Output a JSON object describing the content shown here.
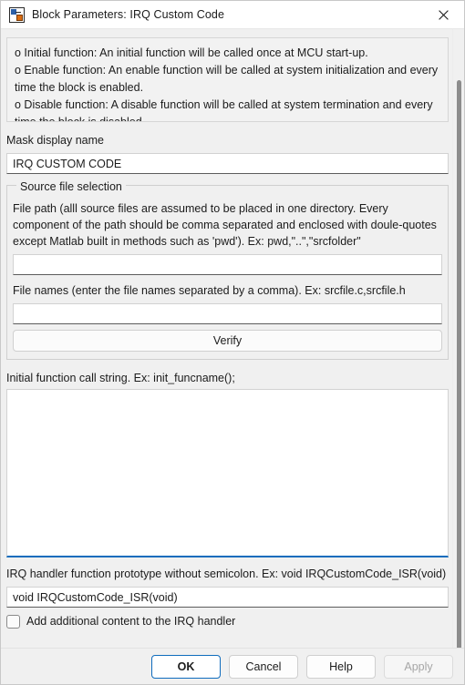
{
  "window": {
    "title": "Block Parameters: IRQ Custom Code",
    "icon": "simulink-block-icon",
    "close_label": "×"
  },
  "description": {
    "lines": [
      "o Initial function: An initial function will be called once at MCU start-up.",
      "o Enable function: An enable function will be called at system initialization and every",
      "time the block is enabled.",
      "o Disable function: A disable function will be called at system termination and every",
      "time the block is disabled."
    ]
  },
  "mask": {
    "label": "Mask display name",
    "value": "IRQ CUSTOM CODE"
  },
  "source_group": {
    "title": "Source file selection",
    "file_path_label": "File path (alll source files are assumed to be placed in one directory. Every component of the path should be comma separated and enclosed with doule-quotes except Matlab built in methods such as 'pwd'). Ex: pwd,\"..\",\"srcfolder\"",
    "file_path_value": "",
    "file_names_label": "File names (enter the file names separated by a comma). Ex: srcfile.c,srcfile.h",
    "file_names_value": "",
    "verify_label": "Verify"
  },
  "init_call": {
    "label": "Initial function call string. Ex: init_funcname();",
    "value": ""
  },
  "irq": {
    "prototype_label": "IRQ handler function prototype without semicolon. Ex: void IRQCustomCode_ISR(void)",
    "prototype_value": "void IRQCustomCode_ISR(void)",
    "checkbox_label": "Add additional content to the IRQ handler",
    "checkbox_checked": false
  },
  "footer": {
    "ok": "OK",
    "cancel": "Cancel",
    "help": "Help",
    "apply": "Apply"
  },
  "colors": {
    "accent": "#0f6cbd",
    "window_bg": "#f0f0f0",
    "field_bg": "#ffffff",
    "text": "#1b1b1b"
  }
}
